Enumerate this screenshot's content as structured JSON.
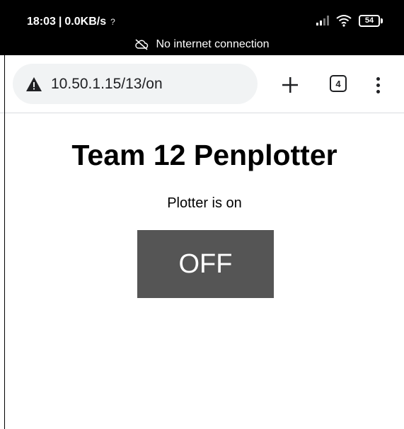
{
  "status_bar": {
    "time": "18:03",
    "separator": "|",
    "data_speed": "0.0KB/s",
    "hotspot_glyph": "?",
    "battery_level": "54",
    "notice": "No internet connection"
  },
  "browser": {
    "url": "10.50.1.15/13/on",
    "tab_count": "4",
    "icons": {
      "security": "warning-triangle-icon",
      "new_tab": "plus-icon",
      "tabs": "tab-switcher-icon",
      "menu": "more-vertical-icon",
      "offline": "cloud-off-icon"
    }
  },
  "page": {
    "title": "Team 12 Penplotter",
    "status_text": "Plotter is on",
    "toggle_label": "OFF"
  },
  "colors": {
    "status_bar_bg": "#000000",
    "url_pill_bg": "#f1f3f4",
    "toggle_bg": "#555555",
    "toggle_text": "#ffffff"
  }
}
